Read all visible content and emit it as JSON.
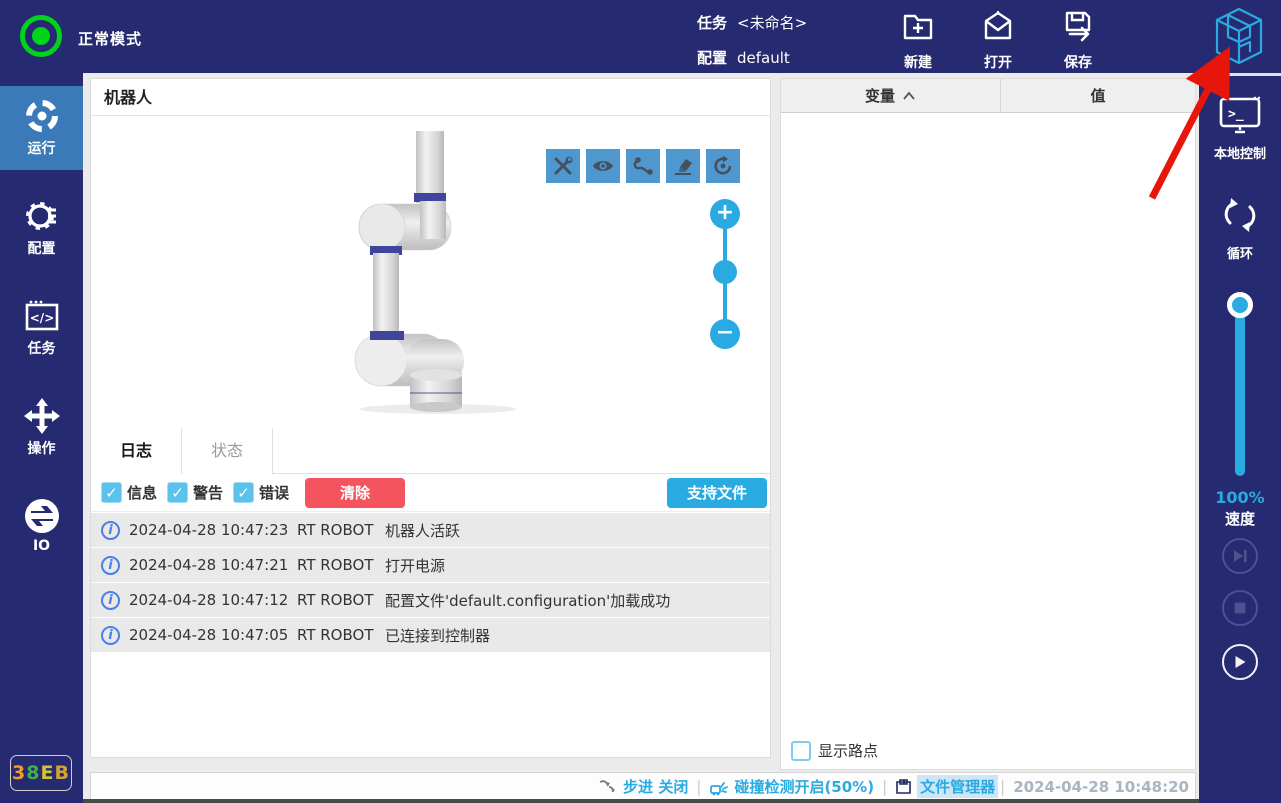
{
  "colors": {
    "navy": "#262a70",
    "accent_blue": "#29abe2",
    "active_nav_blue": "#3b7ab8",
    "danger_red": "#f4545e",
    "status_green": "#00d41a",
    "toolbar_blue": "#4f97cf"
  },
  "topbar": {
    "mode_label": "正常模式",
    "task_label": "任务",
    "task_value": "<未命名>",
    "config_label": "配置",
    "config_value": "default",
    "actions": [
      {
        "label": "新建",
        "icon": "new-folder-icon"
      },
      {
        "label": "打开",
        "icon": "open-icon"
      },
      {
        "label": "保存",
        "icon": "save-icon"
      }
    ],
    "logo_icon": "cube-logo-icon"
  },
  "sidebar": {
    "items": [
      {
        "label": "运行",
        "icon": "run-icon",
        "active": true
      },
      {
        "label": "配置",
        "icon": "config-gear-icon",
        "active": false
      },
      {
        "label": "任务",
        "icon": "task-code-icon",
        "active": false
      },
      {
        "label": "操作",
        "icon": "operate-move-icon",
        "active": false
      },
      {
        "label": "IO",
        "icon": "io-sync-icon",
        "active": false
      }
    ],
    "badge_chars": [
      {
        "ch": "3",
        "style": "color:#f09c2e"
      },
      {
        "ch": "8",
        "style": "color:#3fae4e"
      },
      {
        "ch": "E",
        "style": "color:#d6c32e"
      },
      {
        "ch": "B",
        "style": "color:#d6a32e"
      }
    ]
  },
  "robot_panel": {
    "title": "机器人",
    "toolbar_icons": [
      "tools-icon",
      "eye-icon",
      "path-icon",
      "eraser-icon",
      "rotate-icon"
    ],
    "zoom_plus": "+",
    "zoom_minus": "−"
  },
  "log_panel": {
    "tabs": [
      {
        "label": "日志",
        "active": true
      },
      {
        "label": "状态",
        "active": false
      }
    ],
    "filters": [
      {
        "label": "信息",
        "checked": true
      },
      {
        "label": "警告",
        "checked": true
      },
      {
        "label": "错误",
        "checked": true
      }
    ],
    "check_glyph": "✓",
    "clear_label": "清除",
    "support_label": "支持文件",
    "info_glyph": "i",
    "entries": [
      {
        "time": "2024-04-28 10:47:23",
        "source": "RT ROBOT",
        "message": "机器人活跃"
      },
      {
        "time": "2024-04-28 10:47:21",
        "source": "RT ROBOT",
        "message": "打开电源"
      },
      {
        "time": "2024-04-28 10:47:12",
        "source": "RT ROBOT",
        "message": "配置文件'default.configuration'加载成功"
      },
      {
        "time": "2024-04-28 10:47:05",
        "source": "RT ROBOT",
        "message": "已连接到控制器"
      }
    ]
  },
  "variable_panel": {
    "col_variable": "变量",
    "col_value": "值",
    "show_waypoints_label": "显示路点",
    "show_waypoints_checked": false
  },
  "right_sidebar": {
    "local_control_label": "本地控制",
    "loop_label": "循环",
    "speed_percent": "100%",
    "speed_label": "速度"
  },
  "statusbar": {
    "step_label": "步进 关闭",
    "collision_label": "碰撞检测开启(50%)",
    "file_manager_label": "文件管理器",
    "timestamp": "2024-04-28 10:48:20",
    "separator": "|"
  }
}
